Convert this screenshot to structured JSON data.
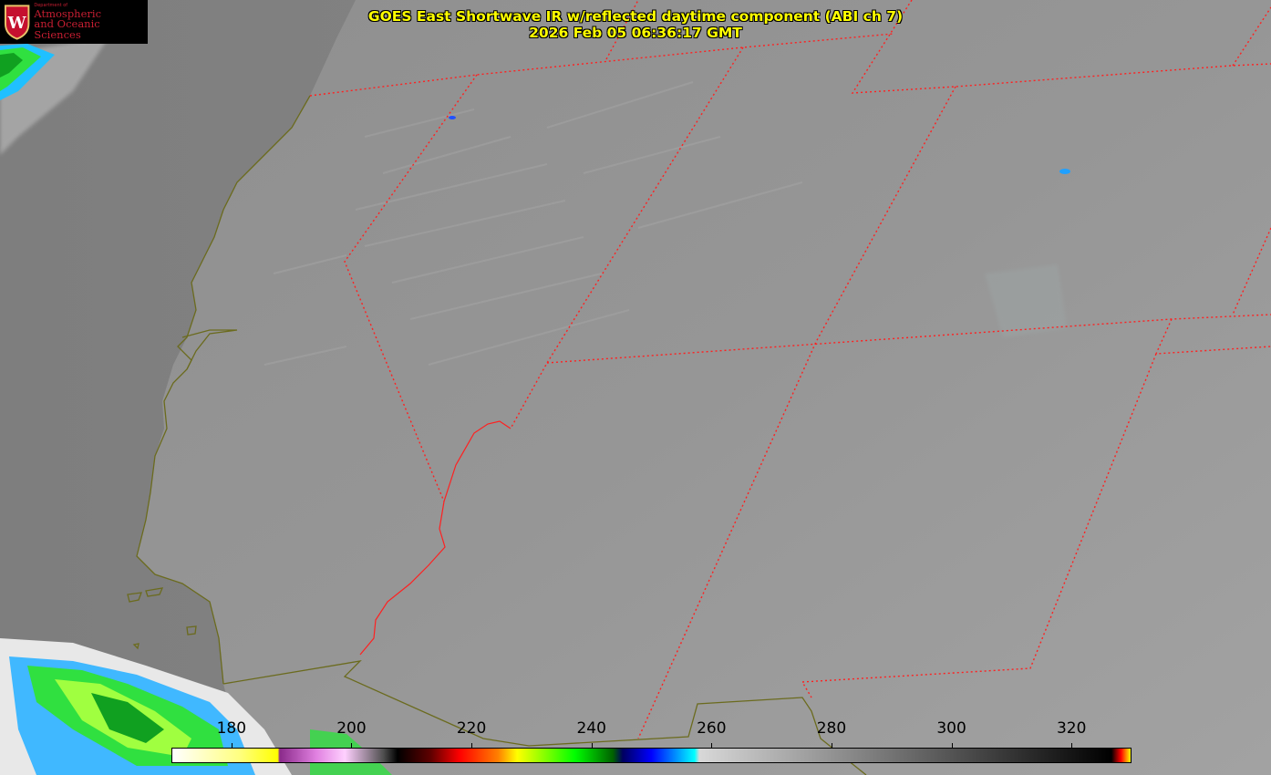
{
  "title": {
    "line1": "GOES East Shortwave IR w/reflected daytime component (ABI ch 7)",
    "line2": "2026 Feb 05 06:36:17 GMT"
  },
  "logo": {
    "department": "Department of",
    "line1": "Atmospheric",
    "line2": "and Oceanic Sciences",
    "crest_letter": "W",
    "color": "#c5102f"
  },
  "colorbar": {
    "min": 170,
    "max": 330,
    "ticks": [
      {
        "value": 180,
        "label": "180"
      },
      {
        "value": 200,
        "label": "200"
      },
      {
        "value": 220,
        "label": "220"
      },
      {
        "value": 240,
        "label": "240"
      },
      {
        "value": 260,
        "label": "260"
      },
      {
        "value": 280,
        "label": "280"
      },
      {
        "value": 300,
        "label": "300"
      },
      {
        "value": 320,
        "label": "320"
      }
    ]
  },
  "colors": {
    "boundaries": "#ff2020",
    "coastline": "#6b6b1e",
    "title": "#ffff00"
  }
}
